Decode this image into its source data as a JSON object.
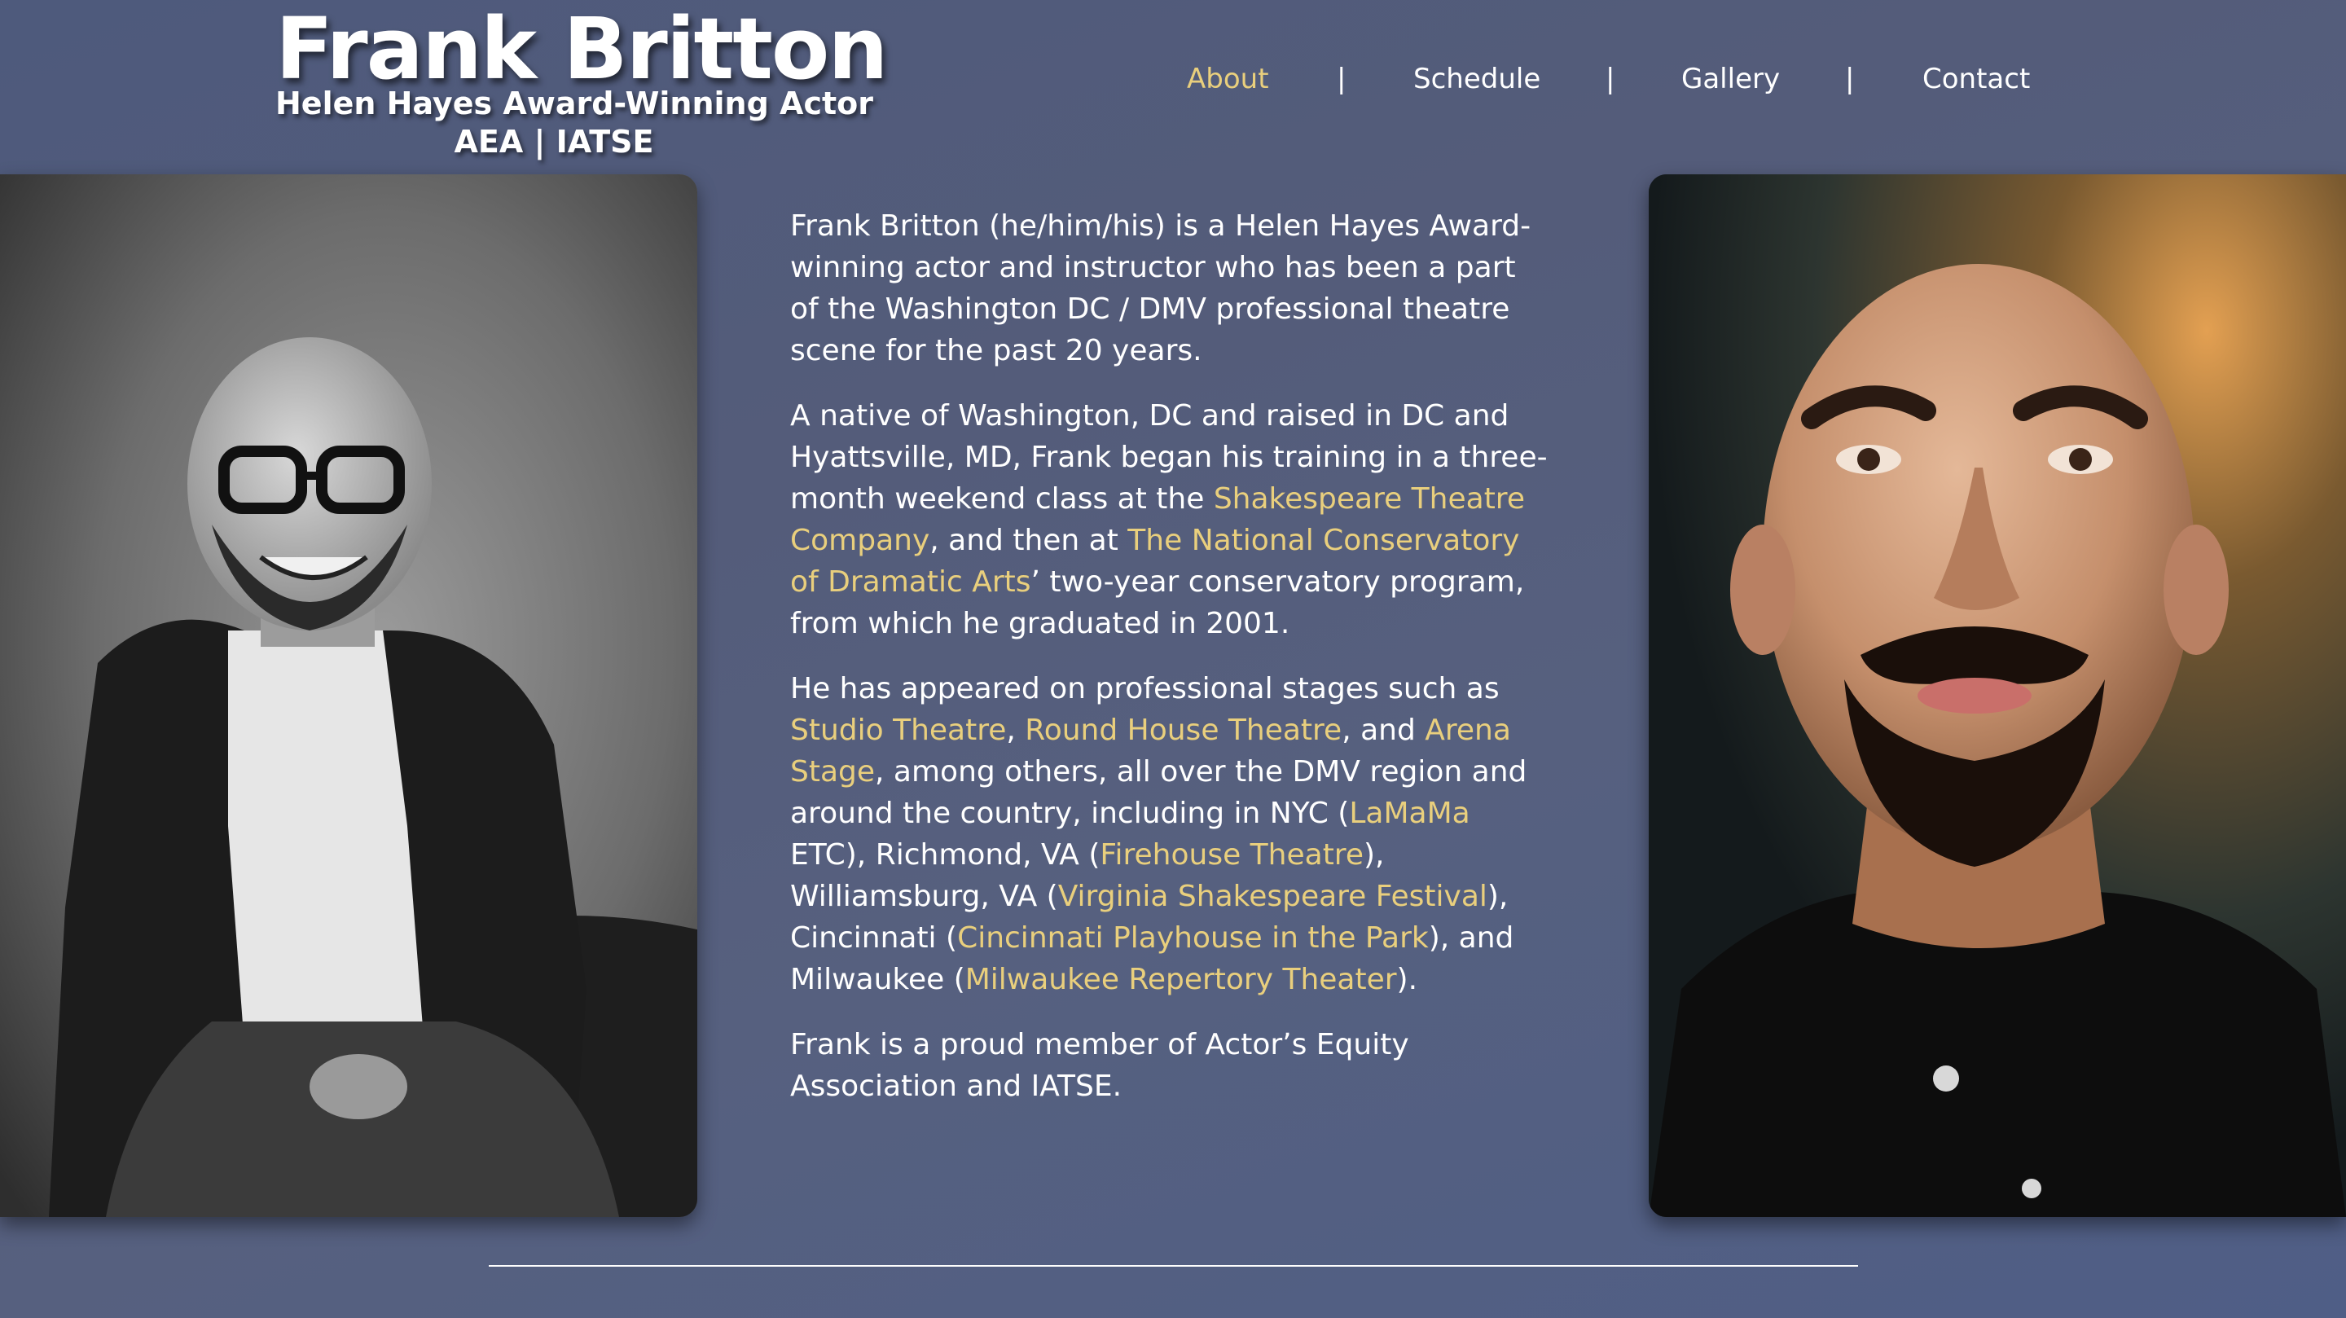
{
  "header": {
    "site_title": "Frank Britton",
    "tagline_1": "Helen Hayes Award-Winning Actor",
    "tagline_2": "AEA | IATSE"
  },
  "nav": {
    "items": [
      {
        "label": "About",
        "active": true
      },
      {
        "label": "Schedule",
        "active": false
      },
      {
        "label": "Gallery",
        "active": false
      },
      {
        "label": "Contact",
        "active": false
      }
    ],
    "separator": "|"
  },
  "bio": {
    "p1": "Frank Britton (he/him/his) is a Helen Hayes Award-winning actor and instructor who has been a part of the Washington DC / DMV professional theatre scene for the past 20 years.",
    "p2": {
      "t1": "A native of Washington, DC and raised in DC and Hyattsville, MD, Frank began his training in a three-month weekend class at the ",
      "link1": "Shakespeare Theatre Company",
      "t2": ", and then at ",
      "link2": "The National Conservatory of Dramatic Arts",
      "t3": "’ two-year conservatory program, from which he graduated in 2001."
    },
    "p3": {
      "t1": "He has appeared on professional stages such as ",
      "link1": "Studio Theatre",
      "t2": ", ",
      "link2": "Round House Theatre",
      "t3": ", and ",
      "link3": "Arena Stage",
      "t4": ", among others, all over the DMV region and around the country, including in NYC (",
      "link4": "LaMaMa",
      "t5": " ETC), Richmond, VA (",
      "link5": "Firehouse Theatre",
      "t6": "), Williamsburg, VA (",
      "link6": "Virginia Shakespeare Festival",
      "t7": "), Cincinnati (",
      "link7": "Cincinnati Playhouse in the Park",
      "t8": "), and Milwaukee (",
      "link8": "Milwaukee Repertory Theater",
      "t9": ")."
    },
    "p4": "Frank is a proud member of Actor’s Equity Association and IATSE."
  },
  "colors": {
    "background": "#545c7a",
    "accent_link": "#e9cf7d",
    "text": "#ffffff"
  }
}
